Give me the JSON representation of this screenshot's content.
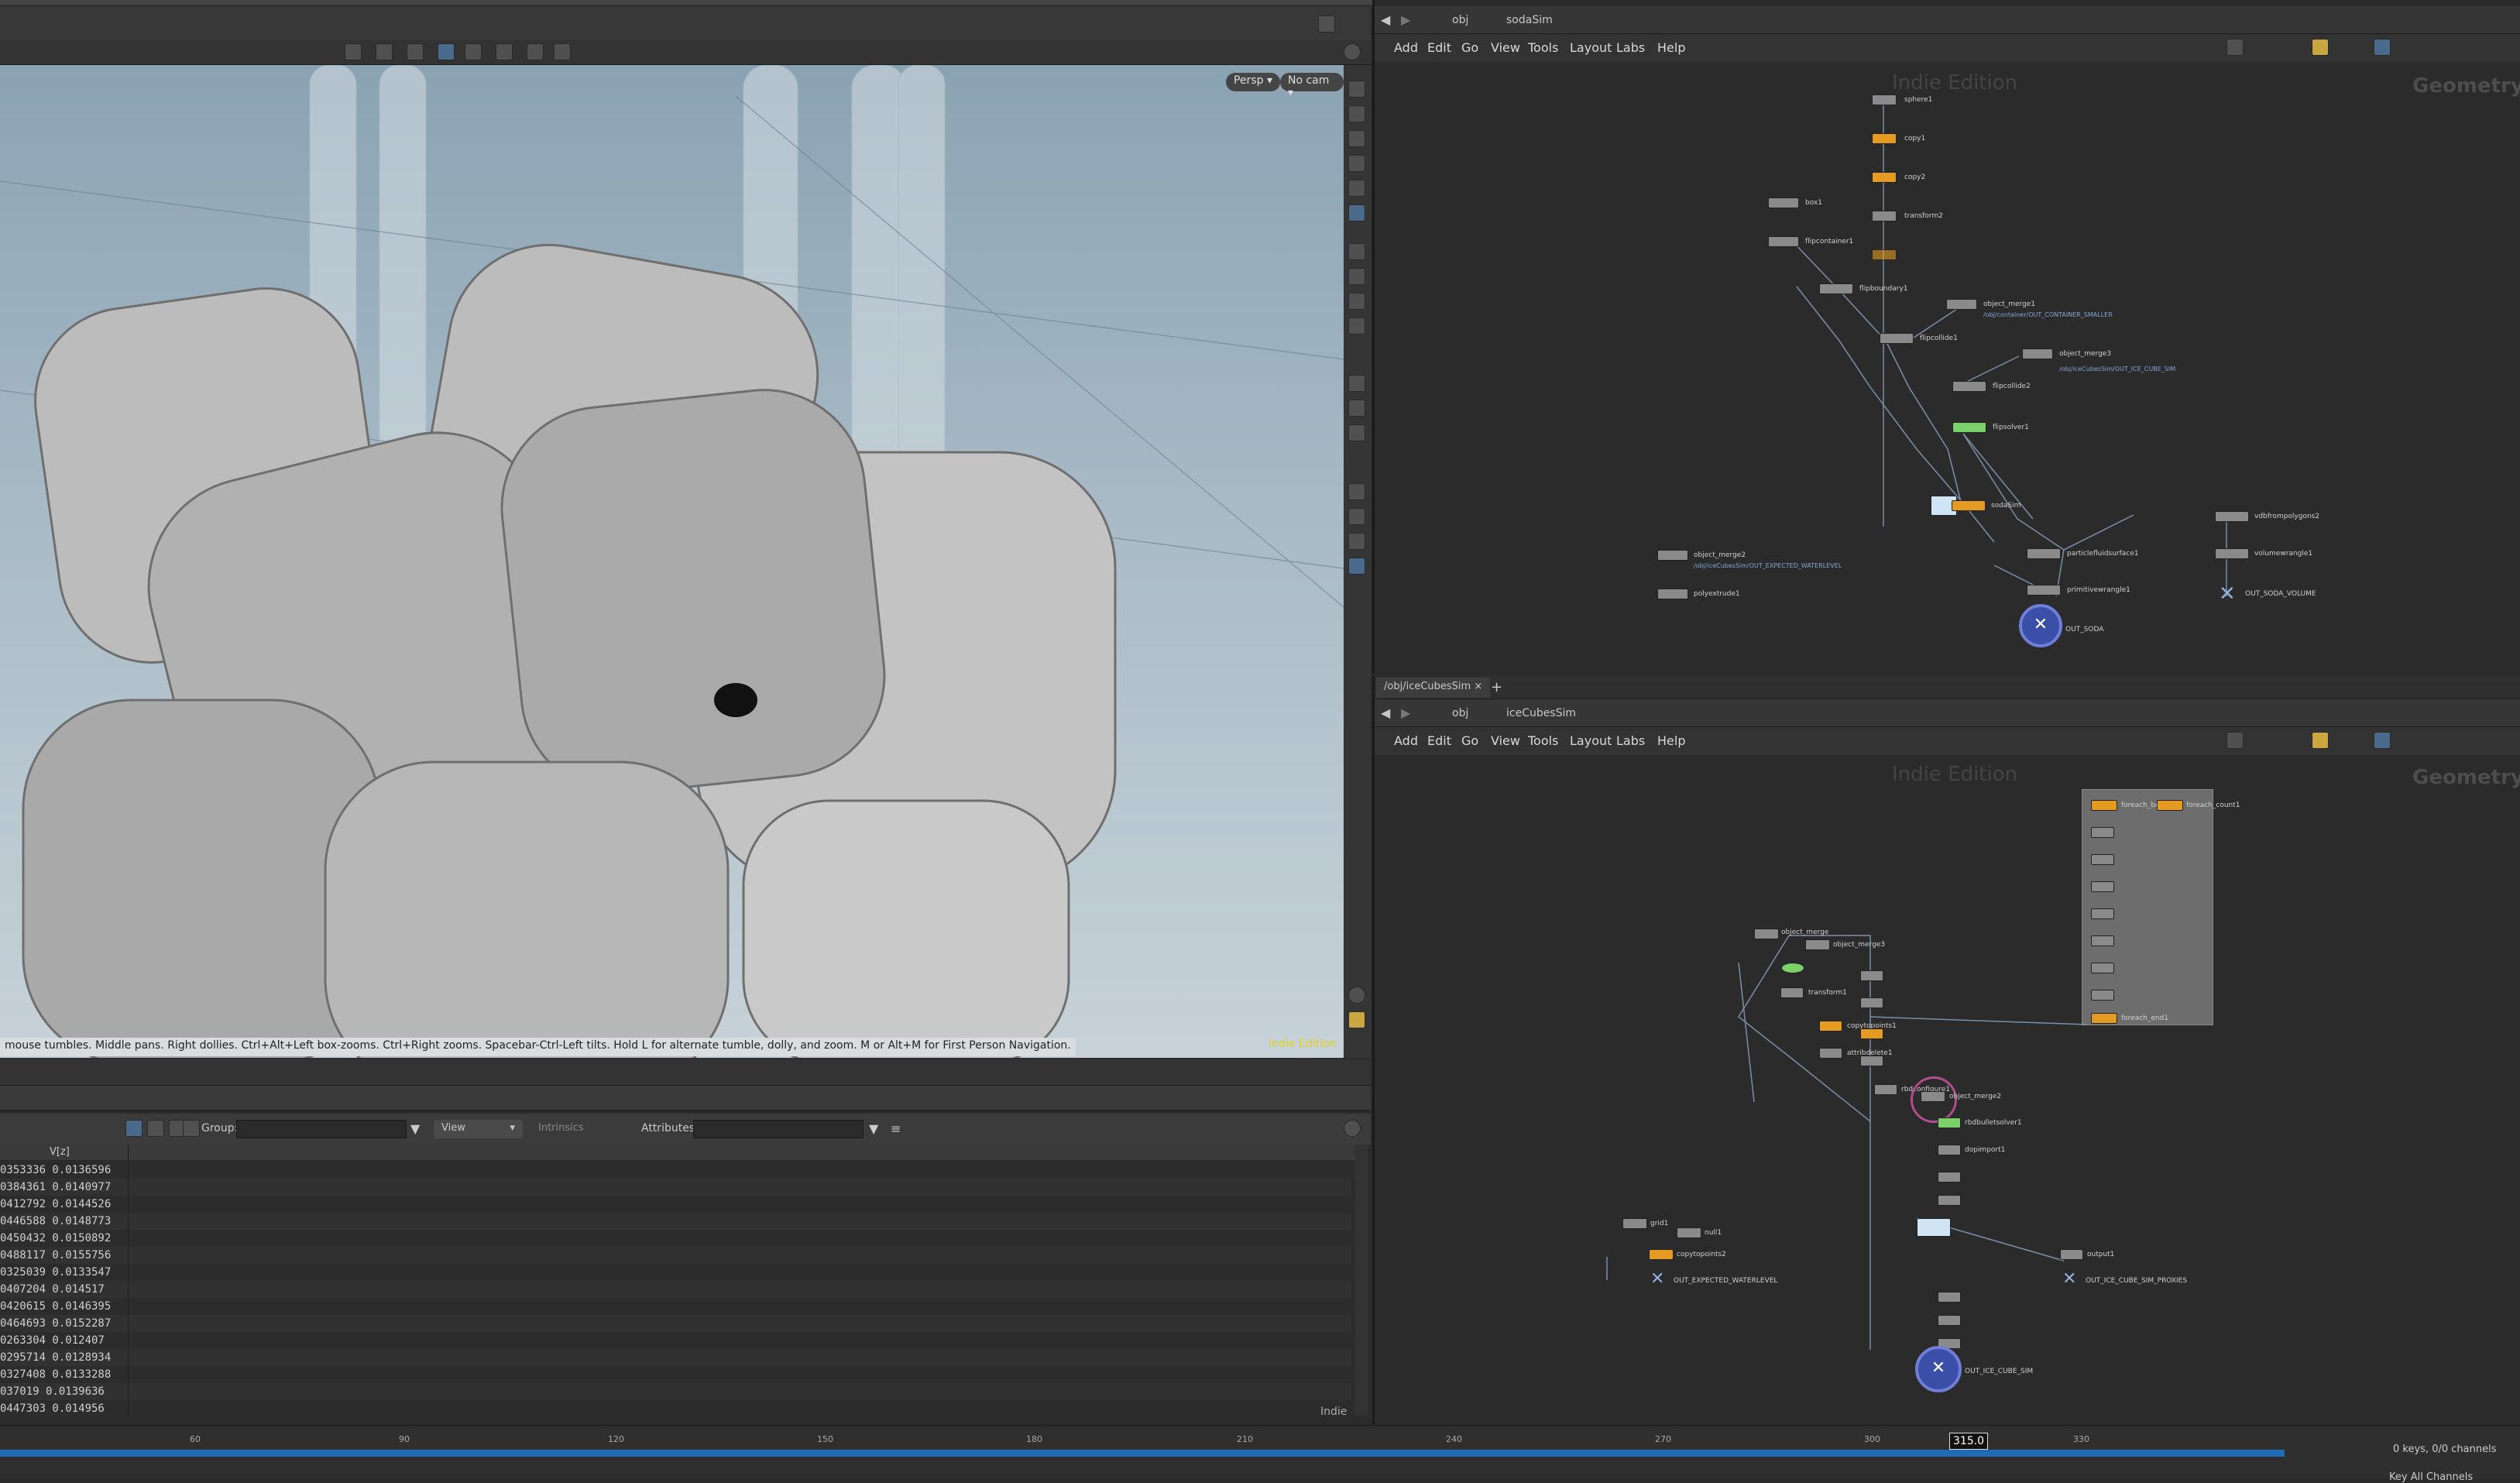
{
  "viewport": {
    "persp_label": "Persp",
    "cam_label": "No cam",
    "status_message": "mouse tumbles. Middle pans. Right dollies. Ctrl+Alt+Left box-zooms. Ctrl+Right zooms. Spacebar-Ctrl-Left tilts. Hold L for alternate tumble, dolly, and zoom. M or Alt+M for First Person Navigation.",
    "watermark": "Indie Edition"
  },
  "spreadsheet": {
    "group_label": "Group:",
    "view_label": "View",
    "intrinsics_label": "Intrinsics",
    "attributes_label": "Attributes:",
    "column_header": "V[z]",
    "rows": [
      "0353336 0.0136596",
      "0384361 0.0140977",
      "0412792 0.0144526",
      "0446588 0.0148773",
      "0450432 0.0150892",
      "0488117 0.0155756",
      "0325039 0.0133547",
      "0407204 0.014517",
      "0420615 0.0146395",
      "0464693 0.0152287",
      "0263304 0.012407",
      "0295714 0.0128934",
      "0327408 0.0133288",
      "037019 0.0139636",
      "0447303 0.014956"
    ],
    "corner_label": "Indie"
  },
  "network_top": {
    "path_obj": "obj",
    "path_node": "sodaSim",
    "menu": [
      "Add",
      "Edit",
      "Go",
      "View",
      "Tools",
      "Layout",
      "Labs",
      "Help"
    ],
    "watermark": "Indie Edition",
    "context_label": "Geometry",
    "nodes": {
      "sphere1": "sphere1",
      "copy1": "copy1",
      "copy2": "copy2",
      "transform2": "transform2",
      "box1": "box1",
      "flipcontainer1": "flipcontainer1",
      "flipboundary1": "flipboundary1",
      "object_merge1": "object_merge1",
      "merge1_path": "/obj/container/OUT_CONTAINER_SMALLER",
      "flipcollide1": "flipcollide1",
      "object_merge3": "object_merge3",
      "merge3_path": "/obj/iceCubesSim/OUT_ICE_CUBE_SIM",
      "flipcollide2": "flipcollide2",
      "flipsolver1": "flipsolver1",
      "sodaSim": "sodaSim",
      "vdbfrompolygons2": "vdbfrompolygons2",
      "object_merge2": "object_merge2",
      "merge2_path": "/obj/iceCubesSim/OUT_EXPECTED_WATERLEVEL",
      "particlefluidsurface1": "particlefluidsurface1",
      "volumewrangle1": "volumewrangle1",
      "polyextrude1": "polyextrude1",
      "primitivewrangle1": "primitivewrangle1",
      "out_soda_volume": "OUT_SODA_VOLUME",
      "out_soda": "OUT_SODA"
    }
  },
  "network_bottom": {
    "tab_label": "/obj/iceCubesSim",
    "path_obj": "obj",
    "path_node": "iceCubesSim",
    "menu": [
      "Add",
      "Edit",
      "Go",
      "View",
      "Tools",
      "Layout",
      "Labs",
      "Help"
    ],
    "watermark": "Indie Edition",
    "context_label": "Geometry",
    "nodes": {
      "object_merge": "object_merge",
      "object_merge3": "object_merge3",
      "foreach_begin": "foreach_begin1",
      "foreach_count": "foreach_count1",
      "foreach_end": "foreach_end1",
      "transform1": "transform1",
      "copytopoints1": "copytopoints1",
      "attribdelete1": "attribdelete1",
      "dopimport1": "dopimport1",
      "rbdconfigure1": "rbdconfigure1",
      "object_merge2": "object_merge2",
      "rbdbulletsolver1": "rbdbulletsolver1",
      "grid1": "grid1",
      "null1": "null1",
      "copytopoints2": "copytopoints2",
      "out_expected_waterlevel": "OUT_EXPECTED_WATERLEVEL",
      "output1": "output1",
      "out_ice_cube_sim_proxies": "OUT_ICE_CUBE_SIM_PROXIES",
      "out_ice_cube_sim": "OUT_ICE_CUBE_SIM"
    }
  },
  "timeline": {
    "ticks": [
      "60",
      "90",
      "120",
      "150",
      "180",
      "210",
      "240",
      "270",
      "300",
      "330"
    ],
    "current_frame": "315.0",
    "keys_status": "0 keys, 0/0 channels",
    "key_all_channels": "Key All Channels"
  }
}
